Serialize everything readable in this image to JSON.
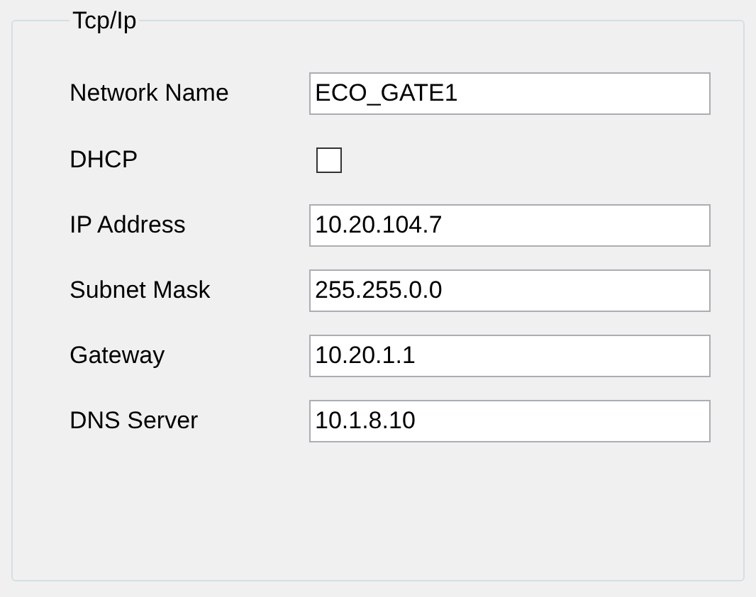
{
  "group": {
    "title": "Tcp/Ip"
  },
  "rows": [
    {
      "kind": "text",
      "label": "Network Name",
      "value": "ECO_GATE1"
    },
    {
      "kind": "checkbox",
      "label": "DHCP",
      "checked": false
    },
    {
      "kind": "text",
      "label": "IP Address",
      "value": "10.20.104.7"
    },
    {
      "kind": "text",
      "label": "Subnet Mask",
      "value": "255.255.0.0"
    },
    {
      "kind": "text",
      "label": "Gateway",
      "value": "10.20.1.1"
    },
    {
      "kind": "text",
      "label": "DNS Server",
      "value": "10.1.8.10"
    }
  ]
}
